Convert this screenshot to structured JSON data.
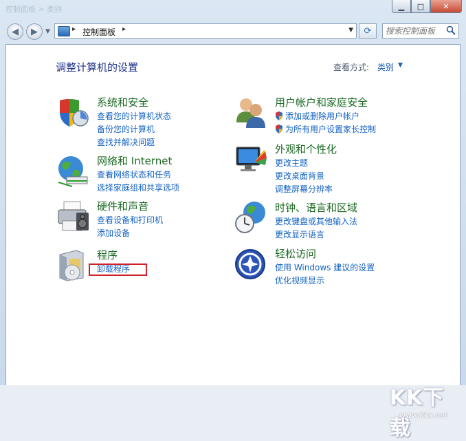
{
  "window": {
    "caption": "控制面板 > 类别",
    "minimize_glyph": "▁",
    "maximize_glyph": "□",
    "close_glyph": "✕"
  },
  "nav": {
    "back_glyph": "◀",
    "forward_glyph": "▶",
    "address_arrow": "▸",
    "breadcrumb": "控制面板",
    "dropdown_glyph": "▼",
    "refresh_glyph": "⟳",
    "search_placeholder": "搜索控制面板"
  },
  "content": {
    "heading": "调整计算机的设置",
    "view_by_label": "查看方式:",
    "view_by_value": "类别",
    "view_by_arrow": "▼"
  },
  "categories": [
    {
      "icon": "security-shield-icon",
      "title": "系统和安全",
      "links": [
        "查看您的计算机状态",
        "备份您的计算机",
        "查找并解决问题"
      ]
    },
    {
      "icon": "network-globe-icon",
      "title": "网络和 Internet",
      "links": [
        "查看网络状态和任务",
        "选择家庭组和共享选项"
      ]
    },
    {
      "icon": "printer-hardware-icon",
      "title": "硬件和声音",
      "links": [
        "查看设备和打印机",
        "添加设备"
      ]
    },
    {
      "icon": "programs-disc-icon",
      "title": "程序",
      "links": [
        "卸载程序"
      ]
    },
    {
      "icon": "users-icon",
      "title": "用户帐户和家庭安全",
      "links": [
        "添加或删除用户帐户",
        "为所有用户设置家长控制"
      ]
    },
    {
      "icon": "appearance-monitor-icon",
      "title": "外观和个性化",
      "links": [
        "更改主题",
        "更改桌面背景",
        "调整屏幕分辨率"
      ]
    },
    {
      "icon": "clock-globe-icon",
      "title": "时钟、语言和区域",
      "links": [
        "更改键盘或其他输入法",
        "更改显示语言"
      ]
    },
    {
      "icon": "ease-of-access-icon",
      "title": "轻松访问",
      "links": [
        "使用 Windows 建议的设置",
        "优化视频显示"
      ]
    }
  ],
  "watermark": {
    "main": "KK下载",
    "url": "www.kkx.net"
  },
  "colors": {
    "category_title": "#1b6a22",
    "link": "#1462c2",
    "heading": "#1e3287",
    "highlight_box": "#d0202a"
  }
}
